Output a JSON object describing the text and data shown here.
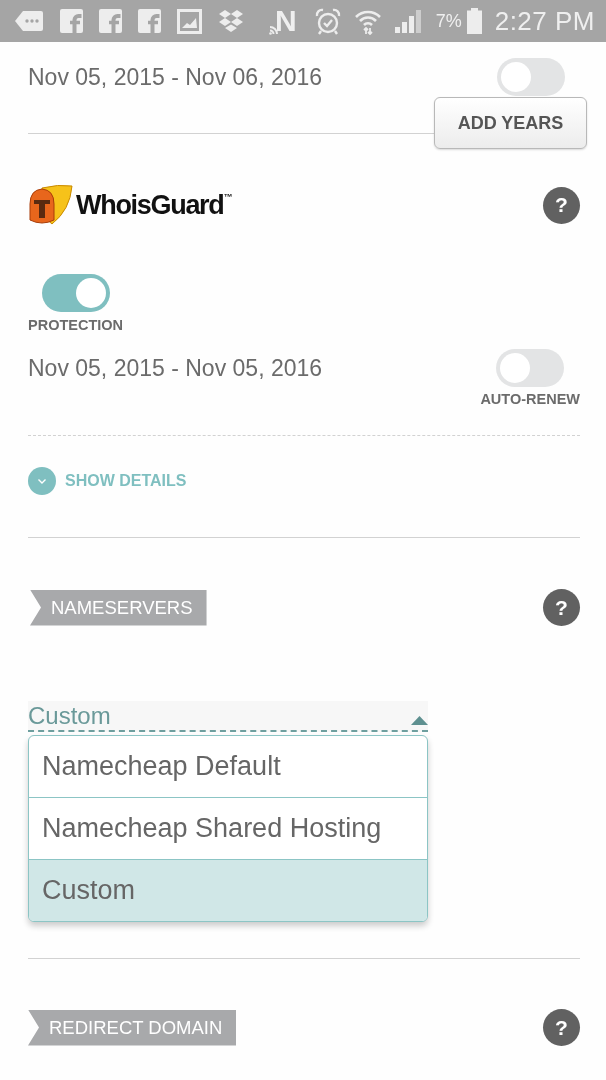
{
  "status_bar": {
    "n_glyph": "N",
    "battery": "7%",
    "time": "2:27 PM"
  },
  "registration": {
    "dates": "Nov 05, 2015 - Nov 06, 2016",
    "toggle_on": false,
    "add_years_button": "ADD YEARS"
  },
  "whoisguard": {
    "logo": "WhoisGuard$^{™}$",
    "help": "?",
    "protection": {
      "label": "PROTECTION",
      "on": true
    },
    "dates": "Nov 05, 2015 - Nov 05, 2016",
    "auto_renew": {
      "label": "AUTO-RENEW",
      "on": false
    },
    "show_details": "SHOW DETAILS"
  },
  "nameservers": {
    "title": "NAMESERVERS",
    "help": "?",
    "select": {
      "value": "Custom",
      "expanded": true,
      "options": [
        {
          "label": "Namecheap Default",
          "selected": false
        },
        {
          "label": "Namecheap Shared Hosting",
          "selected": false
        },
        {
          "label": "Custom",
          "selected": true
        }
      ]
    }
  },
  "redirect_domain": {
    "title": "REDIRECT DOMAIN",
    "help": "?"
  }
}
